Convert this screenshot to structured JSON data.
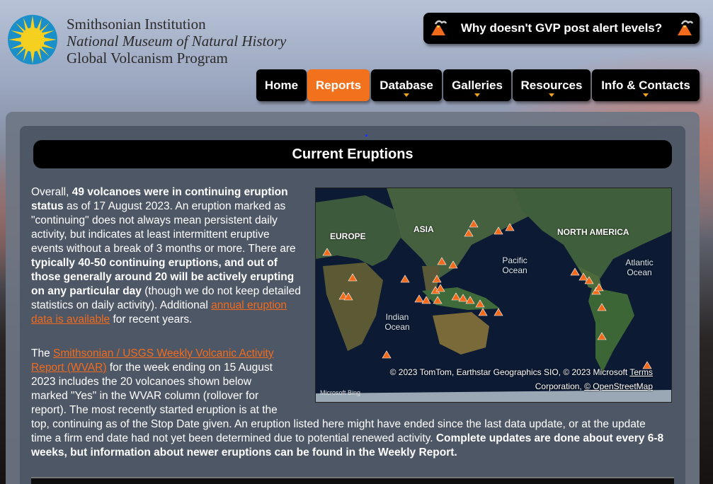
{
  "header": {
    "institution_line1": "Smithsonian Institution",
    "institution_line2": "National Museum of Natural History",
    "institution_line3": "Global Volcanism Program",
    "alert_button": "Why doesn't GVP post alert levels?"
  },
  "nav": {
    "items": [
      {
        "label": "Home",
        "active": false,
        "dropdown": false
      },
      {
        "label": "Reports",
        "active": true,
        "dropdown": false
      },
      {
        "label": "Database",
        "active": false,
        "dropdown": true
      },
      {
        "label": "Galleries",
        "active": false,
        "dropdown": true
      },
      {
        "label": "Resources",
        "active": false,
        "dropdown": true
      },
      {
        "label": "Info & Contacts",
        "active": false,
        "dropdown": true
      }
    ]
  },
  "main": {
    "title": "Current Eruptions",
    "para1": {
      "t1": "Overall, ",
      "b1": "49 volcanoes were in continuing eruption status",
      "t2": " as of 17 August 2023. An eruption marked as \"continuing\" does not always mean persistent daily activity, but indicates at least intermittent eruptive events without a break of 3 months or more. There are ",
      "b2": "typically 40-50 continuing eruptions, and out of those generally around 20 will be actively erupting on any particular day",
      "t3": " (though we do not keep detailed statistics on daily activity). Additional ",
      "link": "annual eruption data is available",
      "t4": " for recent years."
    },
    "para2": {
      "t1": "The ",
      "link": "Smithsonian / USGS Weekly Volcanic Activity Report (WVAR)",
      "t2": " for the week ending on 15 August 2023 includes the 20 volcanoes shown below marked \"Yes\" in the WVAR column (rollover for report). The most recently started eruption is at the top, continuing as of the Stop Date given. An eruption listed here might have ended since the last data update, or at the update time a firm end date had not yet been determined due to potential renewed activity. ",
      "b1": "Complete updates are done about every 6-8 weeks, but information about newer eruptions can be found in the Weekly Report."
    }
  },
  "map": {
    "continents": {
      "europe": "EUROPE",
      "asia": "ASIA",
      "north_america": "NORTH AMERICA"
    },
    "oceans": {
      "pacific": "Pacific Ocean",
      "atlantic": "Atlantic Ocean",
      "indian": "Indian Ocean"
    },
    "attribution_line1": "© 2023 TomTom, Earthstar Geographics SIO, © 2023 Microsoft",
    "attribution_terms": "Terms",
    "attribution_line2a": "Corporation, ",
    "attribution_osm": "© OpenStreetMap",
    "provider_logo": "Microsoft Bing",
    "colors": {
      "ocean": "#0c1a33",
      "land": "#3c5a3a",
      "volcano": "#f26b1c"
    }
  },
  "colors": {
    "accent": "#f2711c",
    "panel": "#4e5766",
    "nav": "#000000"
  }
}
